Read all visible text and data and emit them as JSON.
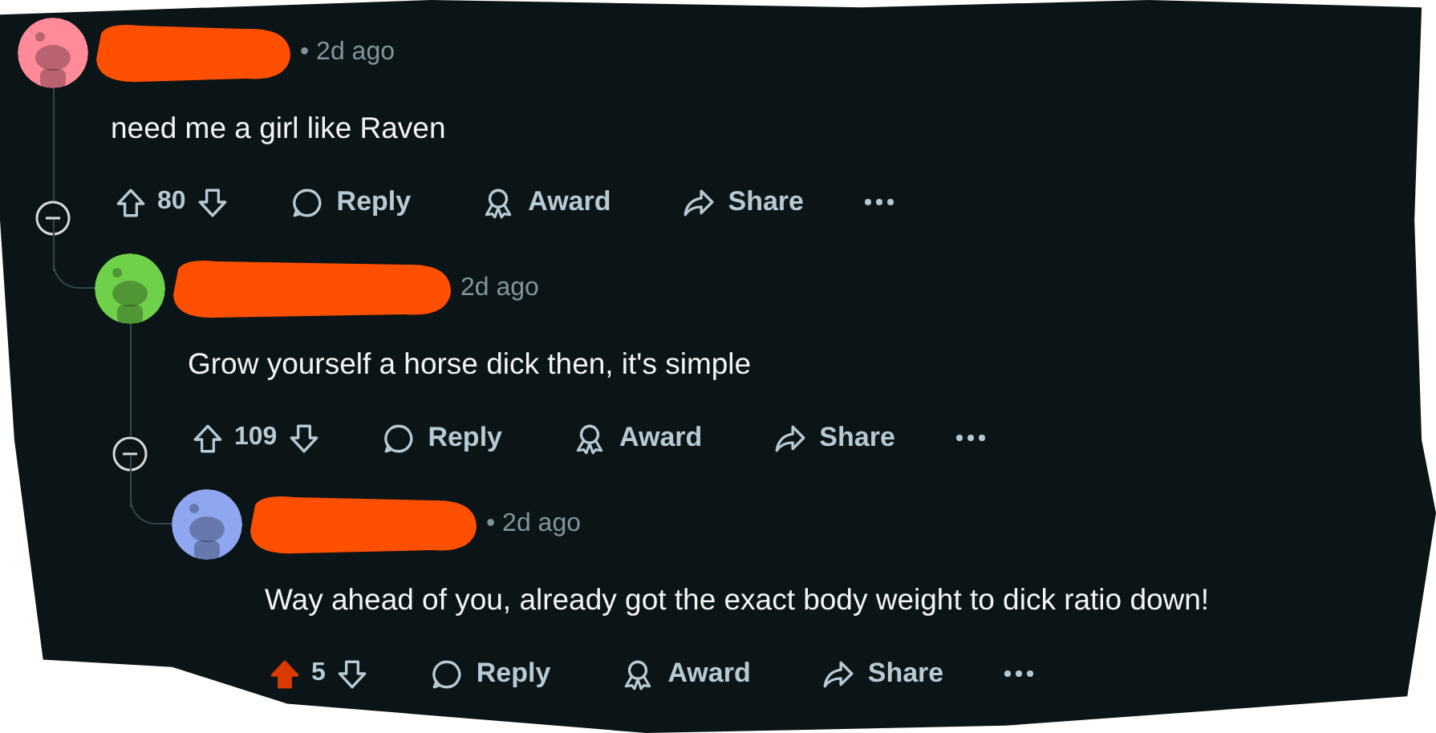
{
  "comments": [
    {
      "author_redacted": true,
      "color": "#ff8a9a",
      "meta": "• 2d ago",
      "text": "need me a girl like Raven",
      "votes": "80",
      "upvoted": false,
      "actions": [
        {
          "kind": "reply",
          "label": "Reply"
        },
        {
          "kind": "award",
          "label": "Award"
        },
        {
          "kind": "share",
          "label": "Share"
        }
      ],
      "children": [
        {
          "author_redacted": true,
          "color": "#6fd04a",
          "meta": "2d ago",
          "text": "Grow yourself a horse dick then, it's simple",
          "votes": "109",
          "upvoted": false,
          "actions": [
            {
              "kind": "reply",
              "label": "Reply"
            },
            {
              "kind": "award",
              "label": "Award"
            },
            {
              "kind": "share",
              "label": "Share"
            }
          ],
          "children": [
            {
              "author_redacted": true,
              "color": "#8fa7f0",
              "meta": "• 2d ago",
              "text": "Way ahead of you, already got the exact body weight to dick ratio down!",
              "votes": "5",
              "upvoted": true,
              "actions": [
                {
                  "kind": "reply",
                  "label": "Reply"
                },
                {
                  "kind": "award",
                  "label": "Award"
                },
                {
                  "kind": "share",
                  "label": "Share"
                }
              ]
            }
          ]
        }
      ]
    }
  ]
}
